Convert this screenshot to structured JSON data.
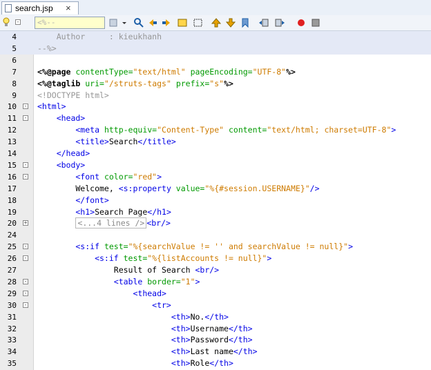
{
  "tab": {
    "filename": "search.jsp",
    "close_symbol": "×"
  },
  "toolbar": {
    "find_value": "<%--"
  },
  "editor": {
    "lines": [
      {
        "n": "4",
        "fold": "",
        "tokens": [
          {
            "t": "    Author     : kieukhanh",
            "c": "c-com"
          }
        ]
      },
      {
        "n": "5",
        "fold": "",
        "tokens": [
          {
            "t": "--%>",
            "c": "c-com"
          }
        ]
      },
      {
        "n": "6",
        "fold": "",
        "tokens": []
      },
      {
        "n": "7",
        "fold": "",
        "tokens": [
          {
            "t": "<%@",
            "c": "c-dir"
          },
          {
            "t": "page",
            "c": "c-dir"
          },
          {
            "t": " contentType=",
            "c": "c-attr"
          },
          {
            "t": "\"text/html\"",
            "c": "c-str"
          },
          {
            "t": " pageEncoding=",
            "c": "c-attr"
          },
          {
            "t": "\"UTF-8\"",
            "c": "c-str"
          },
          {
            "t": "%>",
            "c": "c-dir"
          }
        ]
      },
      {
        "n": "8",
        "fold": "",
        "tokens": [
          {
            "t": "<%@",
            "c": "c-dir"
          },
          {
            "t": "taglib",
            "c": "c-dir"
          },
          {
            "t": " uri=",
            "c": "c-attr"
          },
          {
            "t": "\"/struts-tags\"",
            "c": "c-str"
          },
          {
            "t": " prefix=",
            "c": "c-attr"
          },
          {
            "t": "\"s\"",
            "c": "c-str"
          },
          {
            "t": "%>",
            "c": "c-dir"
          }
        ]
      },
      {
        "n": "9",
        "fold": "",
        "tokens": [
          {
            "t": "<!DOCTYPE html>",
            "c": "c-com"
          }
        ]
      },
      {
        "n": "10",
        "fold": "-",
        "tokens": [
          {
            "t": "<html>",
            "c": "c-tag"
          }
        ]
      },
      {
        "n": "11",
        "fold": "-",
        "tokens": [
          {
            "t": "    <head>",
            "c": "c-tag"
          }
        ]
      },
      {
        "n": "12",
        "fold": "",
        "tokens": [
          {
            "t": "        <meta",
            "c": "c-tag"
          },
          {
            "t": " http-equiv=",
            "c": "c-attr"
          },
          {
            "t": "\"Content-Type\"",
            "c": "c-str"
          },
          {
            "t": " content=",
            "c": "c-attr"
          },
          {
            "t": "\"text/html; charset=UTF-8\"",
            "c": "c-str"
          },
          {
            "t": ">",
            "c": "c-tag"
          }
        ]
      },
      {
        "n": "13",
        "fold": "",
        "tokens": [
          {
            "t": "        <title>",
            "c": "c-tag"
          },
          {
            "t": "Search",
            "c": "c-txt"
          },
          {
            "t": "</title>",
            "c": "c-tag"
          }
        ]
      },
      {
        "n": "14",
        "fold": "",
        "tokens": [
          {
            "t": "    </head>",
            "c": "c-tag"
          }
        ]
      },
      {
        "n": "15",
        "fold": "-",
        "tokens": [
          {
            "t": "    <body>",
            "c": "c-tag"
          }
        ]
      },
      {
        "n": "16",
        "fold": "-",
        "tokens": [
          {
            "t": "        <font",
            "c": "c-tag"
          },
          {
            "t": " color=",
            "c": "c-attr"
          },
          {
            "t": "\"red\"",
            "c": "c-str"
          },
          {
            "t": ">",
            "c": "c-tag"
          }
        ]
      },
      {
        "n": "17",
        "fold": "",
        "tokens": [
          {
            "t": "        Welcome, ",
            "c": "c-txt"
          },
          {
            "t": "<s:property",
            "c": "c-el"
          },
          {
            "t": " value=",
            "c": "c-attr"
          },
          {
            "t": "\"%{#session.USERNAME}\"",
            "c": "c-str"
          },
          {
            "t": "/>",
            "c": "c-el"
          }
        ]
      },
      {
        "n": "18",
        "fold": "",
        "tokens": [
          {
            "t": "        </font>",
            "c": "c-tag"
          }
        ]
      },
      {
        "n": "19",
        "fold": "",
        "tokens": [
          {
            "t": "        <h1>",
            "c": "c-tag"
          },
          {
            "t": "Search Page",
            "c": "c-txt"
          },
          {
            "t": "</h1>",
            "c": "c-tag"
          }
        ]
      },
      {
        "n": "20",
        "fold": "+",
        "tokens": [
          {
            "t": "        ",
            "c": "c-txt"
          },
          {
            "t": "<...4 lines />",
            "c": "collapsed"
          },
          {
            "t": "<br/>",
            "c": "c-tag"
          }
        ]
      },
      {
        "n": "24",
        "fold": "",
        "tokens": []
      },
      {
        "n": "25",
        "fold": "-",
        "tokens": [
          {
            "t": "        <s:if",
            "c": "c-el"
          },
          {
            "t": " test=",
            "c": "c-attr"
          },
          {
            "t": "\"%{searchValue != '' and searchValue != null}\"",
            "c": "c-str"
          },
          {
            "t": ">",
            "c": "c-el"
          }
        ]
      },
      {
        "n": "26",
        "fold": "-",
        "tokens": [
          {
            "t": "            <s:if",
            "c": "c-el"
          },
          {
            "t": " test=",
            "c": "c-attr"
          },
          {
            "t": "\"%{listAccounts != null}\"",
            "c": "c-str"
          },
          {
            "t": ">",
            "c": "c-el"
          }
        ]
      },
      {
        "n": "27",
        "fold": "",
        "tokens": [
          {
            "t": "                Result of Search ",
            "c": "c-txt"
          },
          {
            "t": "<br/>",
            "c": "c-tag"
          }
        ]
      },
      {
        "n": "28",
        "fold": "-",
        "tokens": [
          {
            "t": "                <table",
            "c": "c-tag"
          },
          {
            "t": " border=",
            "c": "c-attr"
          },
          {
            "t": "\"1\"",
            "c": "c-str"
          },
          {
            "t": ">",
            "c": "c-tag"
          }
        ]
      },
      {
        "n": "29",
        "fold": "-",
        "tokens": [
          {
            "t": "                    <thead>",
            "c": "c-tag"
          }
        ]
      },
      {
        "n": "30",
        "fold": "-",
        "tokens": [
          {
            "t": "                        <tr>",
            "c": "c-tag"
          }
        ]
      },
      {
        "n": "31",
        "fold": "",
        "tokens": [
          {
            "t": "                            <th>",
            "c": "c-tag"
          },
          {
            "t": "No.",
            "c": "c-txt"
          },
          {
            "t": "</th>",
            "c": "c-tag"
          }
        ]
      },
      {
        "n": "32",
        "fold": "",
        "tokens": [
          {
            "t": "                            <th>",
            "c": "c-tag"
          },
          {
            "t": "Username",
            "c": "c-txt"
          },
          {
            "t": "</th>",
            "c": "c-tag"
          }
        ]
      },
      {
        "n": "33",
        "fold": "",
        "tokens": [
          {
            "t": "                            <th>",
            "c": "c-tag"
          },
          {
            "t": "Password",
            "c": "c-txt"
          },
          {
            "t": "</th>",
            "c": "c-tag"
          }
        ]
      },
      {
        "n": "34",
        "fold": "",
        "tokens": [
          {
            "t": "                            <th>",
            "c": "c-tag"
          },
          {
            "t": "Last name",
            "c": "c-txt"
          },
          {
            "t": "</th>",
            "c": "c-tag"
          }
        ]
      },
      {
        "n": "35",
        "fold": "",
        "tokens": [
          {
            "t": "                            <th>",
            "c": "c-tag"
          },
          {
            "t": "Role",
            "c": "c-txt"
          },
          {
            "t": "</th>",
            "c": "c-tag"
          }
        ]
      }
    ]
  }
}
